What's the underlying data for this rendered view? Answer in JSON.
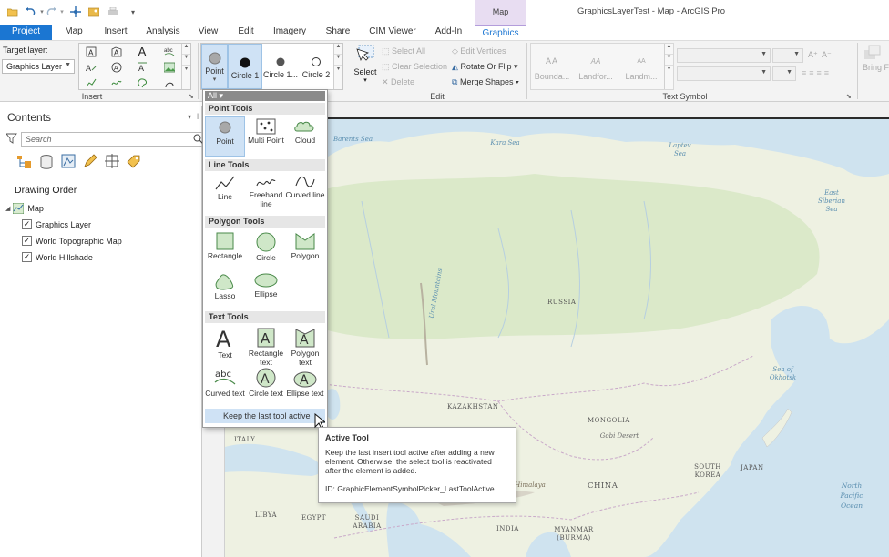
{
  "title_bar": {
    "app_title": "GraphicsLayerTest - Map - ArcGIS Pro",
    "context_group": "Map"
  },
  "tabs": [
    "Project",
    "Map",
    "Insert",
    "Analysis",
    "View",
    "Edit",
    "Imagery",
    "Share",
    "CIM Viewer",
    "Add-In",
    "Graphics"
  ],
  "ribbon": {
    "target_layer_label": "Target layer:",
    "target_layer_value": "Graphics Layer",
    "insert_group": "Insert",
    "gallery_items": [
      "Point",
      "Circle 1",
      "Circle 1...",
      "Circle 2"
    ],
    "select_label": "Select",
    "edit_commands": [
      "Select All",
      "Clear Selection",
      "Delete",
      "Edit Vertices",
      "Rotate Or Flip",
      "Merge Shapes"
    ],
    "edit_group": "Edit",
    "text_symbols": [
      "Bounda...",
      "Landfor...",
      "Landm..."
    ],
    "text_symbol_glyph": "AA",
    "text_symbol_group": "Text Symbol",
    "bring_forward": "Bring Forward"
  },
  "contents": {
    "title": "Contents",
    "search_placeholder": "Search",
    "drawing_order": "Drawing Order",
    "map_node": "Map",
    "layers": [
      "Graphics Layer",
      "World Topographic Map",
      "World Hillshade"
    ]
  },
  "dropdown": {
    "filter": "All",
    "point_tools_header": "Point Tools",
    "point_tools": [
      "Point",
      "Multi Point",
      "Cloud"
    ],
    "line_tools_header": "Line Tools",
    "line_tools": [
      "Line",
      "Freehand line",
      "Curved line"
    ],
    "polygon_tools_header": "Polygon Tools",
    "polygon_tools": [
      "Rectangle",
      "Circle",
      "Polygon",
      "Lasso",
      "Ellipse"
    ],
    "text_tools_header": "Text Tools",
    "text_tools": [
      "Text",
      "Rectangle text",
      "Polygon text",
      "Curved text",
      "Circle text",
      "Ellipse text"
    ],
    "keep_active": "Keep the last tool active"
  },
  "tooltip": {
    "title": "Active Tool",
    "body": "Keep the last insert tool active after adding a new element.  Otherwise, the select tool is reactivated after the element is added.",
    "id": "ID: GraphicElementSymbolPicker_LastToolActive"
  },
  "map_labels": {
    "barents_sea": "Barents Sea",
    "kara_sea": "Kara Sea",
    "laptev_sea": "Laptev Sea",
    "east_siberian_sea": "East Siberian Sea",
    "ural_mountains": "Ural Mountains",
    "russia": "RUSSIA",
    "kazakhstan": "KAZAKHSTAN",
    "mongolia": "MONGOLIA",
    "gobi_desert": "Gobi Desert",
    "sea_of_okhotsk": "Sea of Okhotsk",
    "italy": "ITALY",
    "south_korea": "SOUTH KOREA",
    "japan": "JAPAN",
    "china": "CHINA",
    "north_pacific_ocean": "North Pacific Ocean",
    "libya": "LIBYA",
    "egypt": "EGYPT",
    "saudi_arabia": "SAUDI ARABIA",
    "himalaya": "Himalaya",
    "india": "INDIA",
    "myanmar": "MYANMAR (BURMA)"
  },
  "colors": {
    "accent": "#1b76d2",
    "context": "#b39ddb",
    "selection": "#cfe2f5"
  }
}
